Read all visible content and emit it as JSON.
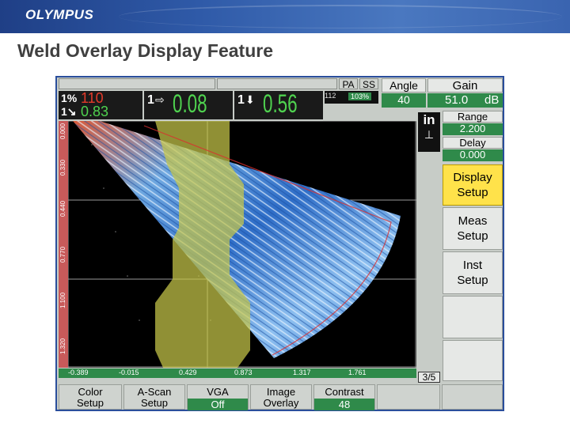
{
  "banner": {
    "logo": "OLYMPUS"
  },
  "slide": {
    "title": "Weld Overlay Display Feature"
  },
  "device": {
    "gate_a": {
      "main": "110",
      "sub": "0.83"
    },
    "reading1": {
      "label": "1",
      "value": "0.08"
    },
    "reading2": {
      "label": "1",
      "value": "0.56"
    },
    "mode_pa": "PA",
    "mode_ss": "SS",
    "small_a": "112",
    "percent": "103%",
    "angle": {
      "label": "Angle",
      "value": "40"
    },
    "gain": {
      "label": "Gain",
      "value": "51.0",
      "unit": "dB"
    },
    "units": "in",
    "range": {
      "label": "Range",
      "value": "2.200"
    },
    "delay": {
      "label": "Delay",
      "value": "0.000"
    },
    "menu": [
      {
        "line1": "Display",
        "line2": "Setup"
      },
      {
        "line1": "Meas",
        "line2": "Setup"
      },
      {
        "line1": "Inst",
        "line2": "Setup"
      }
    ],
    "y_ticks": [
      "0.000",
      "0.330",
      "0.440",
      "0.770",
      "1.100",
      "1.320"
    ],
    "x_ticks": [
      "-0.389",
      "-0.015",
      "0.429",
      "0.873",
      "1.317",
      "1.761"
    ],
    "page": "3/5",
    "bottom": {
      "color": {
        "line1": "Color",
        "line2": "Setup"
      },
      "ascan": {
        "line1": "A-Scan",
        "line2": "Setup"
      },
      "vga": {
        "label": "VGA",
        "value": "Off"
      },
      "overlay": {
        "line1": "Image",
        "line2": "Overlay"
      },
      "contrast": {
        "label": "Contrast",
        "value": "48"
      }
    },
    "colors": {
      "accent": "#2f8a4a",
      "selected": "#ffe24a",
      "overlay": "#c8c84a"
    }
  }
}
